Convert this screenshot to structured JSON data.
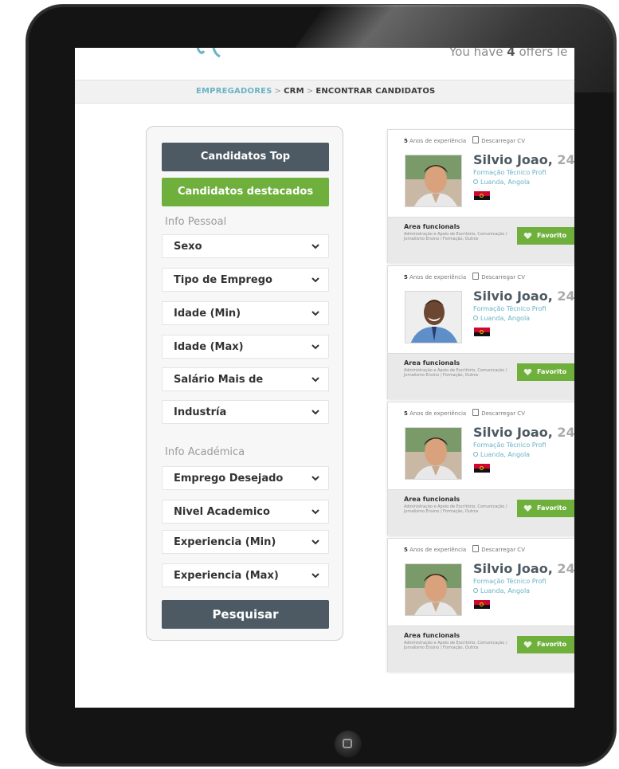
{
  "header": {
    "offers_prefix": "You have",
    "offers_count": "4",
    "offers_suffix": "offers le"
  },
  "breadcrumb": {
    "part1": "EMPREGADORES",
    "sep1": ">",
    "part2": "CRM",
    "sep2": ">",
    "part3": "ENCONTRAR CANDIDATOS"
  },
  "sidebar": {
    "top_button": "Candidatos Top",
    "featured_button": "Candidatos destacados",
    "personal_section": "Info Pessoal",
    "personal_filters": [
      "Sexo",
      "Tipo de Emprego",
      "Idade (Min)",
      "Idade (Max)",
      "Salário Mais de",
      "Industría"
    ],
    "academic_section": "Info Académica",
    "academic_filters": [
      "Emprego Desejado",
      "Nivel Academico",
      "Experiencia (Min)",
      "Experiencia (Max)"
    ],
    "search_button": "Pesquisar"
  },
  "cards": [
    {
      "years": "5",
      "exp_label": "Anos de experiência",
      "download": "Descarregar CV",
      "name": "Silvio Joao,",
      "age": "24",
      "education": "Formação Técnico Profi",
      "location": "Luanda, Angola",
      "area_title": "Area funcionals",
      "area_text": "Administração e Apoio de Escritório, Comunicação / Jornalismo Ensino / Formação, Outros",
      "fav": "Favorito"
    },
    {
      "years": "5",
      "exp_label": "Anos de experiência",
      "download": "Descarregar CV",
      "name": "Silvio Joao,",
      "age": "24",
      "education": "Formação Técnico Profi",
      "location": "Luanda, Angola",
      "area_title": "Area funcionals",
      "area_text": "Administração e Apoio de Escritório, Comunicação / Jornalismo Ensino / Formação, Outros",
      "fav": "Favorito"
    },
    {
      "years": "5",
      "exp_label": "Anos de experiência",
      "download": "Descarregar CV",
      "name": "Silvio Joao,",
      "age": "24",
      "education": "Formação Técnico Profi",
      "location": "Luanda, Angola",
      "area_title": "Area funcionals",
      "area_text": "Administração e Apoio de Escritório, Comunicação / Jornalismo Ensino / Formação, Outros",
      "fav": "Favorito"
    },
    {
      "years": "5",
      "exp_label": "Anos de experiência",
      "download": "Descarregar CV",
      "name": "Silvio Joao,",
      "age": "24",
      "education": "Formação Técnico Profi",
      "location": "Luanda, Angola",
      "area_title": "Area funcionals",
      "area_text": "Administração e Apoio de Escritório, Comunicação / Jornalismo Ensino / Formação, Outros",
      "fav": "Favorito"
    }
  ],
  "colors": {
    "accent_blue": "#6ab3c6",
    "accent_green": "#6fb03d",
    "dark_slate": "#4d5a63"
  }
}
